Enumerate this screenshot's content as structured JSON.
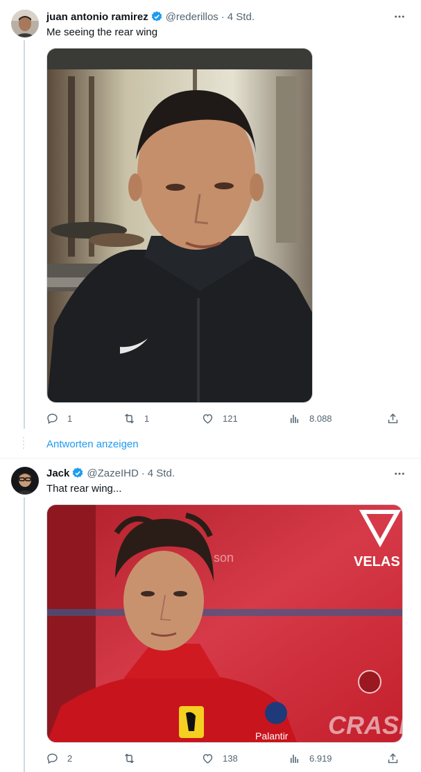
{
  "tweets": [
    {
      "author_name": "juan antonio ramirez",
      "handle": "@rederillos",
      "time": "4 Std.",
      "text": "Me seeing the rear wing",
      "replies": "1",
      "retweets": "1",
      "likes": "121",
      "views": "8.088"
    },
    {
      "author_name": "Jack",
      "handle": "@ZazeIHD",
      "time": "4 Std.",
      "text": "That rear wing...",
      "replies": "2",
      "retweets": "",
      "likes": "138",
      "views": "6.919"
    }
  ],
  "show_replies_label": "Antworten anzeigen",
  "separator": "·",
  "media2_brand_text": "CRASH",
  "media2_sponsor_text": "VELAS",
  "colors": {
    "accent": "#1d9bf0",
    "secondary_text": "#536471",
    "ferrari_red": "#d4202b"
  },
  "icons": [
    "verified-badge-icon",
    "more-icon",
    "reply-icon",
    "retweet-icon",
    "like-icon",
    "views-icon",
    "share-icon"
  ]
}
